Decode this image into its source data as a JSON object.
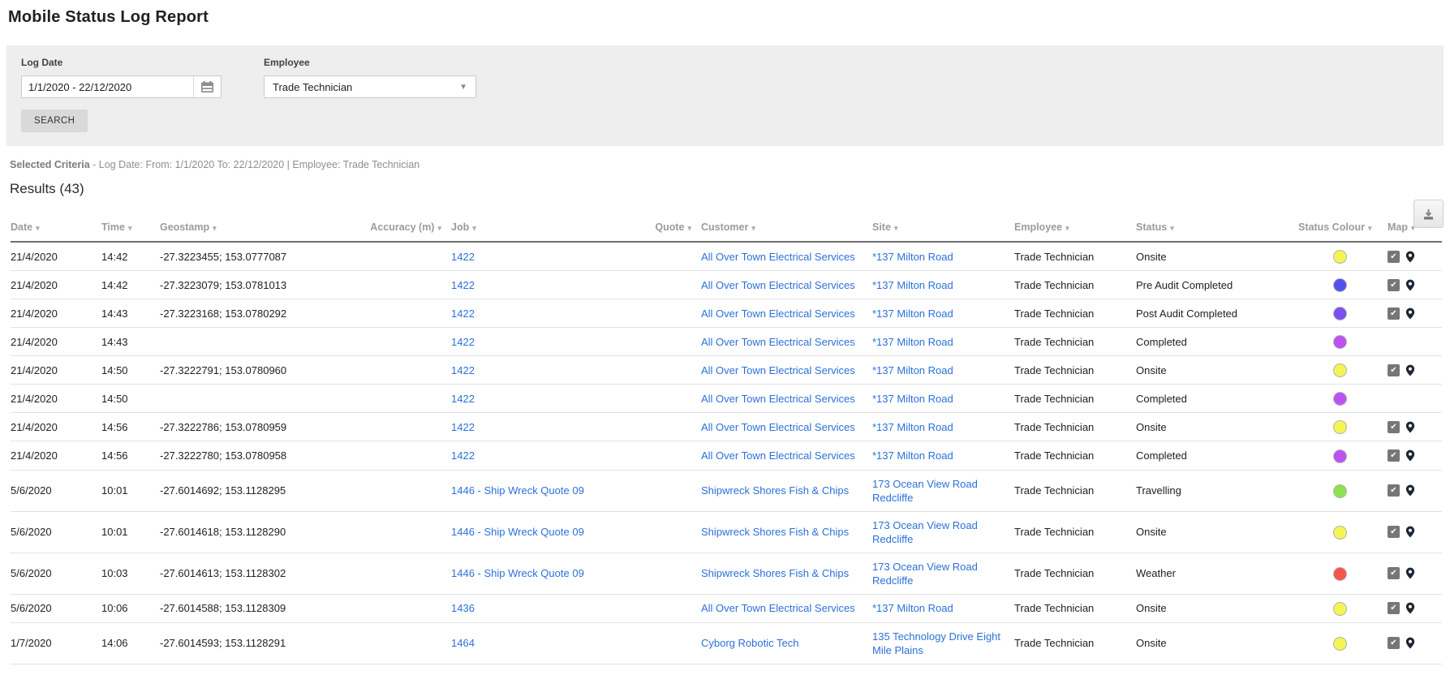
{
  "page": {
    "title": "Mobile Status Log Report"
  },
  "filters": {
    "log_date": {
      "label": "Log Date",
      "value": "1/1/2020 - 22/12/2020",
      "icon": "calendar-icon"
    },
    "employee": {
      "label": "Employee",
      "value": "Trade Technician",
      "icon": "chevron-down-icon"
    },
    "search_label": "SEARCH"
  },
  "selected_criteria": {
    "label": "Selected Criteria",
    "text": " - Log Date: From: 1/1/2020 To: 22/12/2020 | Employee: Trade Technician"
  },
  "results": {
    "title": "Results (43)",
    "export_icon": "download-icon"
  },
  "colors": {
    "link_blue": "#2c70d8",
    "status_yellow": "#f5f455",
    "status_blue": "#5351ee",
    "status_blue_violet": "#7b4ff0",
    "status_purple": "#bc52f0",
    "status_green": "#8ce24f",
    "status_red": "#f4564c",
    "panel_grey": "#eeeeee",
    "header_grey": "#9b9b9b"
  },
  "table": {
    "columns": [
      {
        "key": "date",
        "label": "Date"
      },
      {
        "key": "time",
        "label": "Time"
      },
      {
        "key": "geostamp",
        "label": "Geostamp"
      },
      {
        "key": "accuracy",
        "label": "Accuracy (m)",
        "align": "right"
      },
      {
        "key": "job",
        "label": "Job",
        "link": true
      },
      {
        "key": "quote",
        "label": "Quote",
        "align": "right",
        "link": true
      },
      {
        "key": "customer",
        "label": "Customer",
        "link": true
      },
      {
        "key": "site",
        "label": "Site",
        "link": true
      },
      {
        "key": "employee",
        "label": "Employee"
      },
      {
        "key": "status",
        "label": "Status"
      },
      {
        "key": "status_colour",
        "label": "Status Colour",
        "type": "colour"
      },
      {
        "key": "map",
        "label": "Map",
        "type": "map"
      }
    ],
    "rows": [
      {
        "date": "21/4/2020",
        "time": "14:42",
        "geostamp": "-27.3223455; 153.0777087",
        "accuracy": "",
        "job": "1422",
        "quote": "",
        "customer": "All Over Town Electrical Services",
        "site": "*137 Milton Road",
        "employee": "Trade Technician",
        "status": "Onsite",
        "status_colour": "#f5f455",
        "map": true
      },
      {
        "date": "21/4/2020",
        "time": "14:42",
        "geostamp": "-27.3223079; 153.0781013",
        "accuracy": "",
        "job": "1422",
        "quote": "",
        "customer": "All Over Town Electrical Services",
        "site": "*137 Milton Road",
        "employee": "Trade Technician",
        "status": "Pre Audit Completed",
        "status_colour": "#5351ee",
        "map": true
      },
      {
        "date": "21/4/2020",
        "time": "14:43",
        "geostamp": "-27.3223168; 153.0780292",
        "accuracy": "",
        "job": "1422",
        "quote": "",
        "customer": "All Over Town Electrical Services",
        "site": "*137 Milton Road",
        "employee": "Trade Technician",
        "status": "Post Audit Completed",
        "status_colour": "#7b4ff0",
        "map": true
      },
      {
        "date": "21/4/2020",
        "time": "14:43",
        "geostamp": "",
        "accuracy": "",
        "job": "1422",
        "quote": "",
        "customer": "All Over Town Electrical Services",
        "site": "*137 Milton Road",
        "employee": "Trade Technician",
        "status": "Completed",
        "status_colour": "#bc52f0",
        "map": false
      },
      {
        "date": "21/4/2020",
        "time": "14:50",
        "geostamp": "-27.3222791; 153.0780960",
        "accuracy": "",
        "job": "1422",
        "quote": "",
        "customer": "All Over Town Electrical Services",
        "site": "*137 Milton Road",
        "employee": "Trade Technician",
        "status": "Onsite",
        "status_colour": "#f5f455",
        "map": true
      },
      {
        "date": "21/4/2020",
        "time": "14:50",
        "geostamp": "",
        "accuracy": "",
        "job": "1422",
        "quote": "",
        "customer": "All Over Town Electrical Services",
        "site": "*137 Milton Road",
        "employee": "Trade Technician",
        "status": "Completed",
        "status_colour": "#bc52f0",
        "map": false
      },
      {
        "date": "21/4/2020",
        "time": "14:56",
        "geostamp": "-27.3222786; 153.0780959",
        "accuracy": "",
        "job": "1422",
        "quote": "",
        "customer": "All Over Town Electrical Services",
        "site": "*137 Milton Road",
        "employee": "Trade Technician",
        "status": "Onsite",
        "status_colour": "#f5f455",
        "map": true
      },
      {
        "date": "21/4/2020",
        "time": "14:56",
        "geostamp": "-27.3222780; 153.0780958",
        "accuracy": "",
        "job": "1422",
        "quote": "",
        "customer": "All Over Town Electrical Services",
        "site": "*137 Milton Road",
        "employee": "Trade Technician",
        "status": "Completed",
        "status_colour": "#bc52f0",
        "map": true
      },
      {
        "date": "5/6/2020",
        "time": "10:01",
        "geostamp": "-27.6014692; 153.1128295",
        "accuracy": "",
        "job": "1446 - Ship Wreck Quote 09",
        "quote": "",
        "customer": "Shipwreck Shores Fish & Chips",
        "site": "173 Ocean View Road Redcliffe",
        "employee": "Trade Technician",
        "status": "Travelling",
        "status_colour": "#8ce24f",
        "map": true
      },
      {
        "date": "5/6/2020",
        "time": "10:01",
        "geostamp": "-27.6014618; 153.1128290",
        "accuracy": "",
        "job": "1446 - Ship Wreck Quote 09",
        "quote": "",
        "customer": "Shipwreck Shores Fish & Chips",
        "site": "173 Ocean View Road Redcliffe",
        "employee": "Trade Technician",
        "status": "Onsite",
        "status_colour": "#f5f455",
        "map": true
      },
      {
        "date": "5/6/2020",
        "time": "10:03",
        "geostamp": "-27.6014613; 153.1128302",
        "accuracy": "",
        "job": "1446 - Ship Wreck Quote 09",
        "quote": "",
        "customer": "Shipwreck Shores Fish & Chips",
        "site": "173 Ocean View Road Redcliffe",
        "employee": "Trade Technician",
        "status": "Weather",
        "status_colour": "#f4564c",
        "map": true
      },
      {
        "date": "5/6/2020",
        "time": "10:06",
        "geostamp": "-27.6014588; 153.1128309",
        "accuracy": "",
        "job": "1436",
        "quote": "",
        "customer": "All Over Town Electrical Services",
        "site": "*137 Milton Road",
        "employee": "Trade Technician",
        "status": "Onsite",
        "status_colour": "#f5f455",
        "map": true
      },
      {
        "date": "1/7/2020",
        "time": "14:06",
        "geostamp": "-27.6014593; 153.1128291",
        "accuracy": "",
        "job": "1464",
        "quote": "",
        "customer": "Cyborg Robotic Tech",
        "site": "135 Technology Drive Eight Mile Plains",
        "employee": "Trade Technician",
        "status": "Onsite",
        "status_colour": "#f5f455",
        "map": true
      }
    ]
  }
}
